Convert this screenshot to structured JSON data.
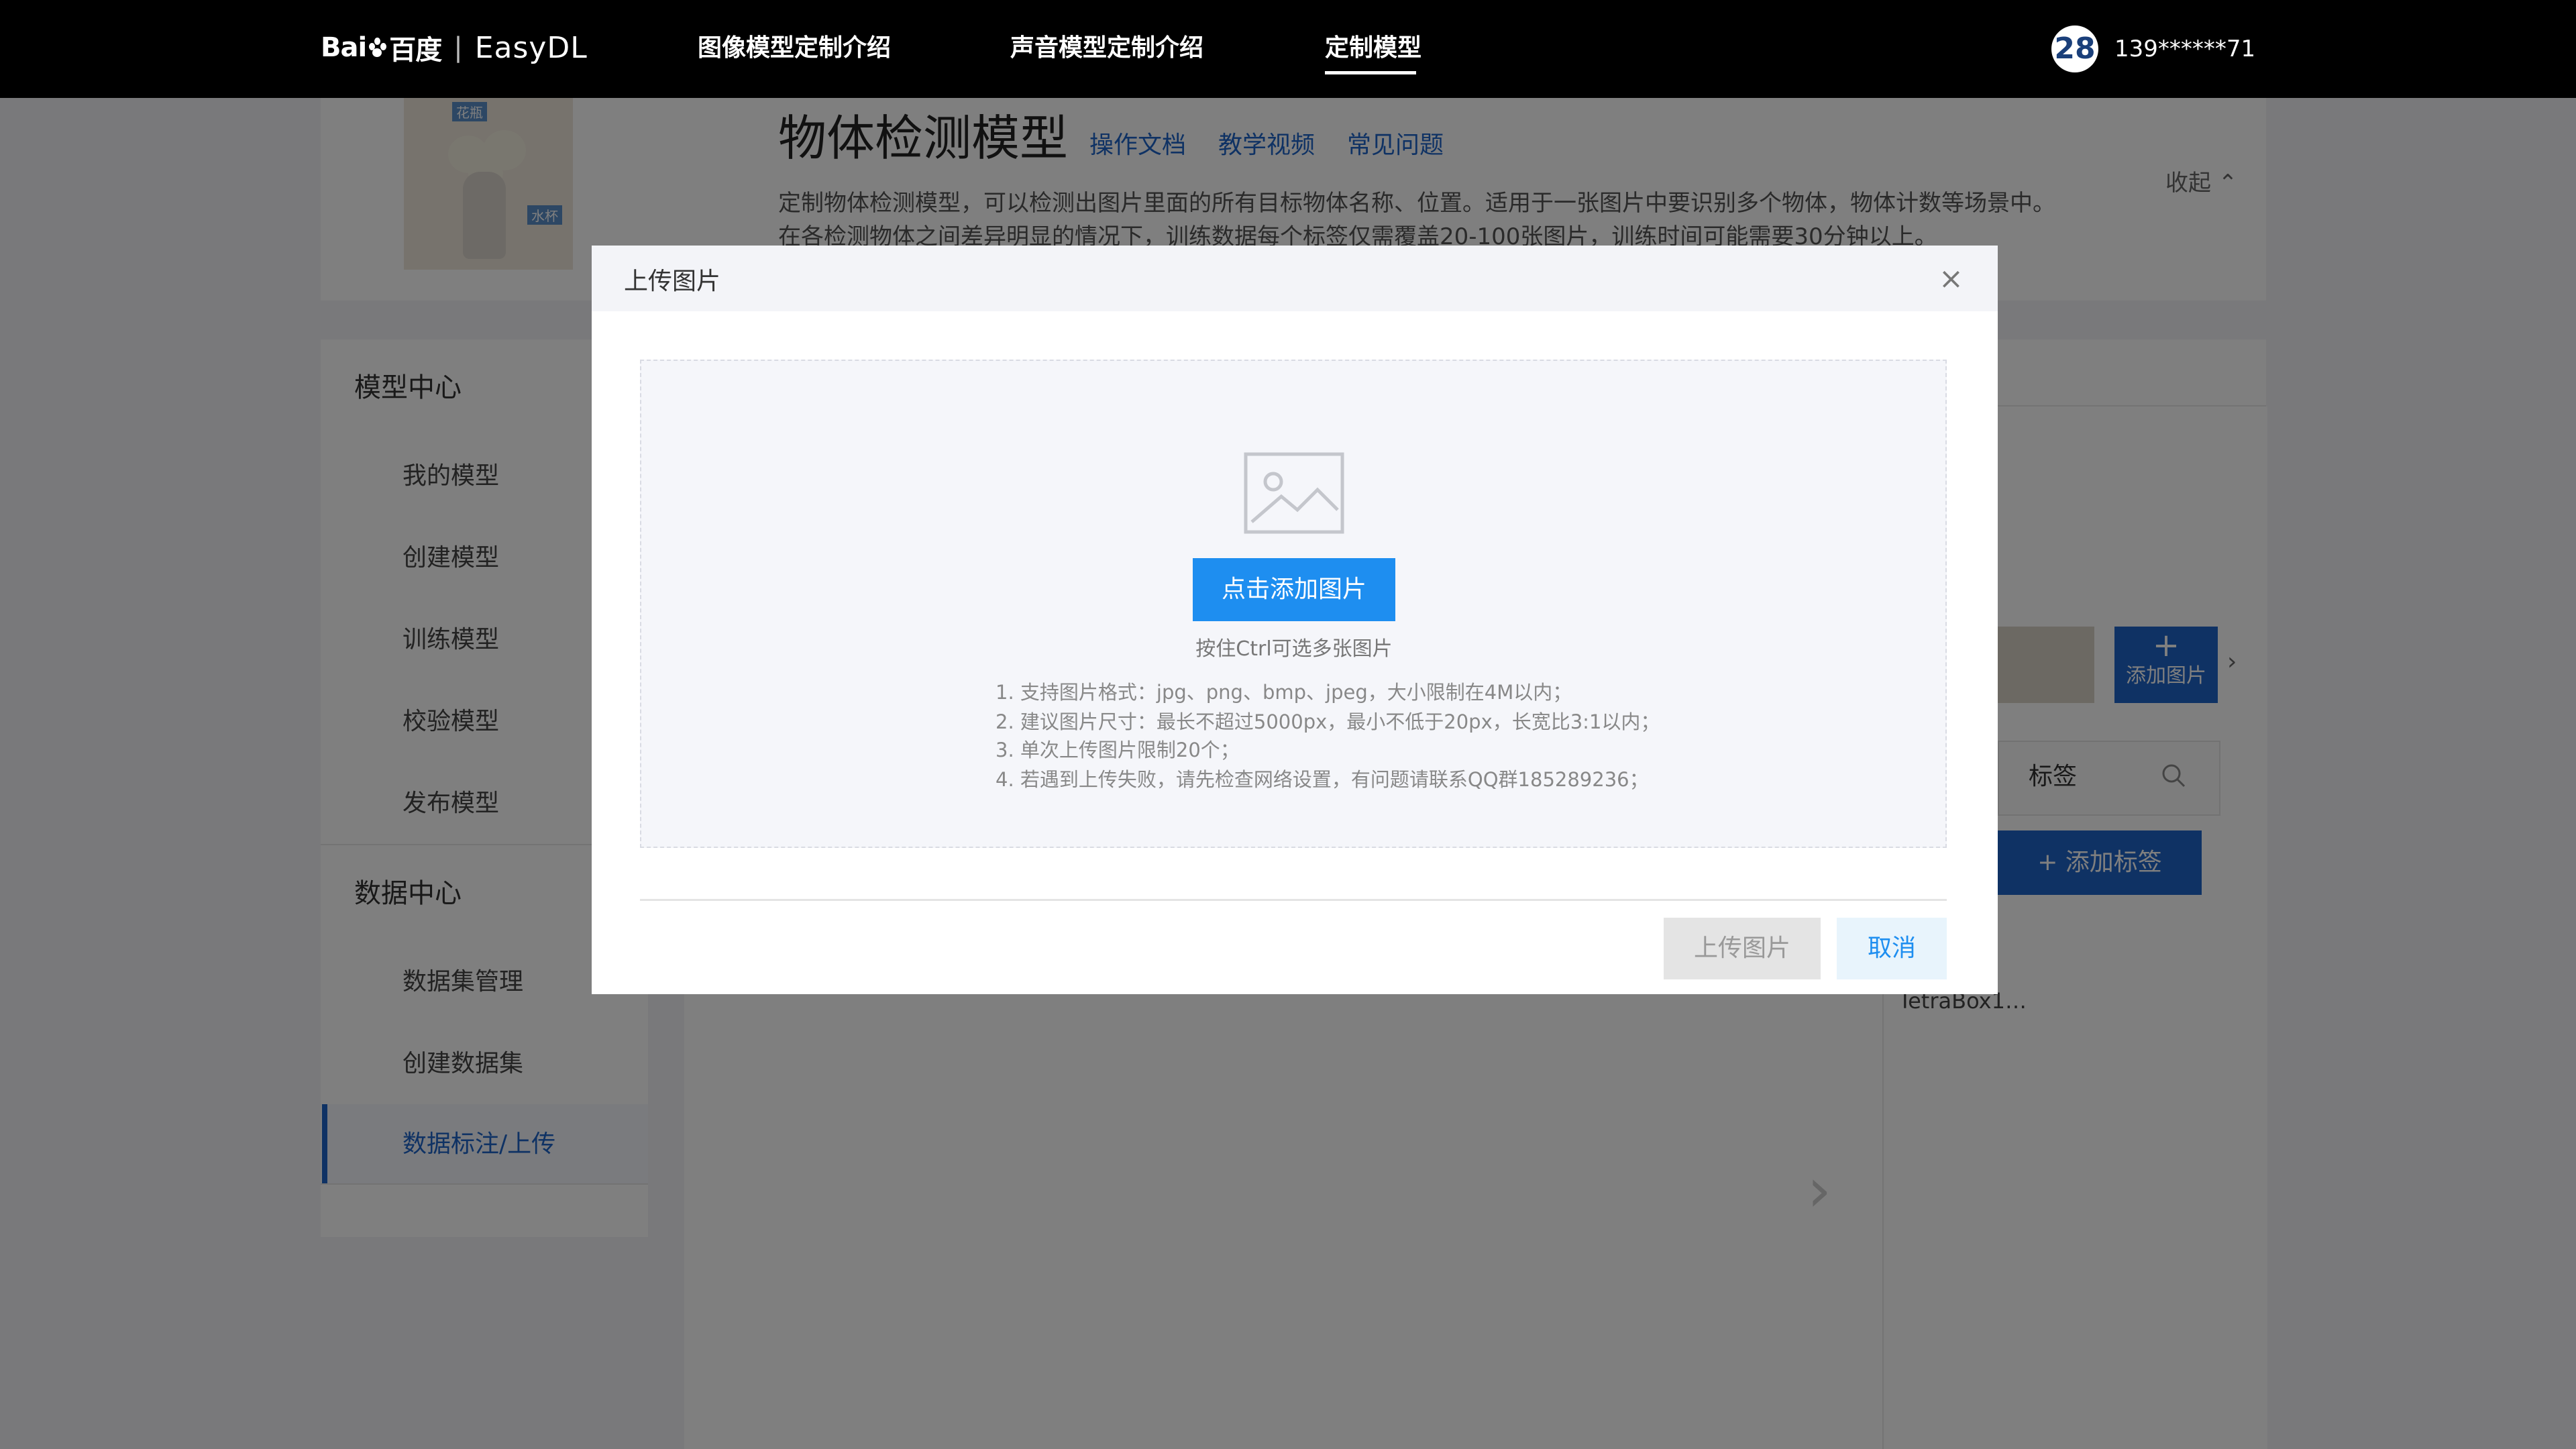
{
  "nav": {
    "logo_left": "Bai",
    "logo_right": "百度",
    "product": "EasyDL",
    "items": [
      "图像模型定制介绍",
      "声音模型定制介绍",
      "定制模型"
    ],
    "active_item": "定制模型",
    "avatar_text": "28",
    "user": "139******71"
  },
  "banner": {
    "image_tag_top": "花瓶",
    "image_tag_side": "水杯",
    "title": "物体检测模型",
    "links": [
      "操作文档",
      "教学视频",
      "常见问题"
    ],
    "description_line1": "定制物体检测模型，可以检测出图片里面的所有目标物体名称、位置。适用于一张图片中要识别多个物体，物体计数等场景中。",
    "description_line2": "在各检测物体之间差异明显的情况下，训练数据每个标签仅需覆盖20-100张图片，训练时间可能需要30分钟以上。",
    "collapse": "收起 ⌃"
  },
  "sidebar": {
    "model_center": "模型中心",
    "model_items": [
      "我的模型",
      "创建模型",
      "训练模型",
      "校验模型",
      "发布模型"
    ],
    "data_center": "数据中心",
    "data_items": [
      "数据集管理",
      "创建数据集",
      "数据标注/上传"
    ],
    "active_item": "数据标注/上传"
  },
  "workspace": {
    "add_image_plus": "+",
    "add_image": "添加图片",
    "thumb_next": "›",
    "tag_header": "标签",
    "add_tag": "+ 添加标签",
    "tags": [
      "…",
      "TetraBox1…"
    ],
    "next_arrow": "›"
  },
  "modal": {
    "title": "上传图片",
    "close": "×",
    "add_button": "点击添加图片",
    "hint": "按住Ctrl可选多张图片",
    "rules": [
      "1. 支持图片格式：jpg、png、bmp、jpeg，大小限制在4M以内；",
      "2. 建议图片尺寸：最长不超过5000px，最小不低于20px，长宽比3:1以内；",
      "3. 单次上传图片限制20个；",
      "4. 若遇到上传失败，请先检查网络设置，有问题请联系QQ群185289236；"
    ],
    "upload_button": "上传图片",
    "cancel_button": "取消"
  },
  "colors": {
    "nav_bg": "#000000",
    "accent": "#1e64c8",
    "modal_primary": "#1e8ef0",
    "mask": "rgba(0,0,0,0.5)"
  }
}
